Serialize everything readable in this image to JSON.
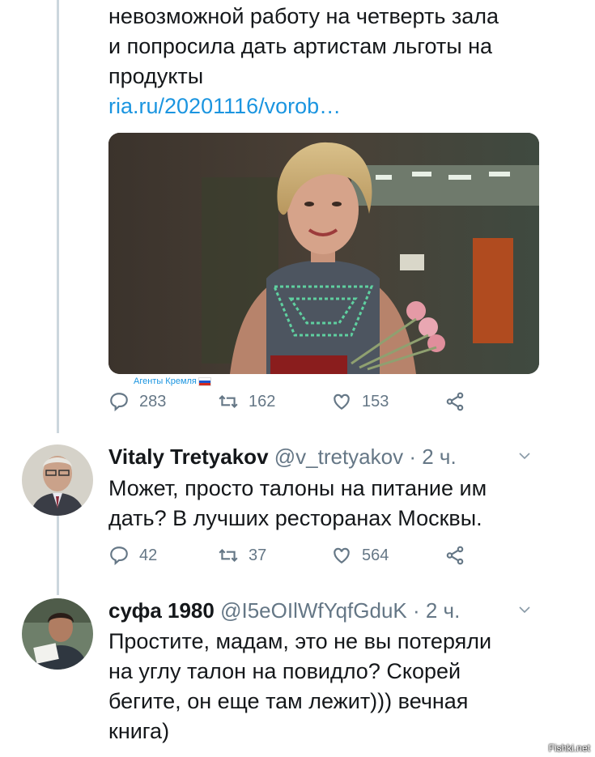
{
  "tweet": {
    "text_lines": [
      "невозможной работу на четверть зала",
      "и попросила дать артистам льготы на",
      "продукты"
    ],
    "link": "ria.ru/20201116/vorob…",
    "media_watermark": "Агенты Кремля",
    "actions": {
      "replies": "283",
      "retweets": "162",
      "likes": "153"
    }
  },
  "replies": [
    {
      "name": "Vitaly Tretyakov",
      "handle": "@v_tretyakov · 2 ч.",
      "text_lines": [
        "Может, просто талоны на питание им",
        "дать? В лучших ресторанах Москвы."
      ],
      "actions": {
        "replies": "42",
        "retweets": "37",
        "likes": "564"
      }
    },
    {
      "name": "суфа 1980",
      "handle": "@I5eOIlWfYqfGduK · 2 ч.",
      "text_lines": [
        "Простите, мадам, это не вы потеряли",
        "на углу талон на повидло? Скорей",
        "бегите, он еще там лежит))) вечная",
        "книга)"
      ]
    }
  ],
  "watermark": "Fishki.net",
  "colors": {
    "link": "#1b95e0",
    "secondary": "#657786",
    "thread": "#ccd6dd"
  }
}
